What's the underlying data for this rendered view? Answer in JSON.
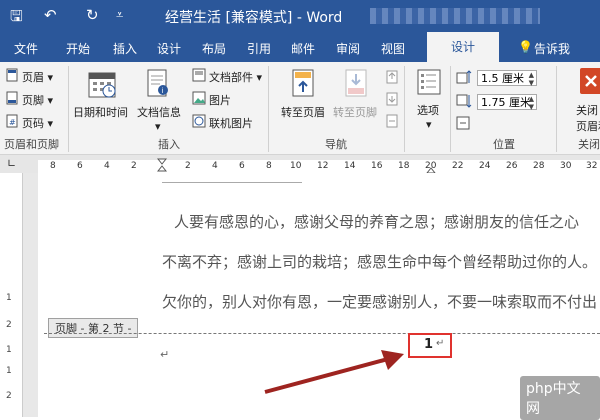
{
  "titlebar": {
    "title": "经营生活 [兼容模式] - Word",
    "quick_access": [
      {
        "name": "save-icon",
        "glyph": "🖫"
      },
      {
        "name": "undo-icon",
        "glyph": "↶"
      },
      {
        "name": "redo-icon",
        "glyph": "↻"
      },
      {
        "name": "customize-icon",
        "glyph": "⩡"
      }
    ]
  },
  "tabs": {
    "file": "文件",
    "home": "开始",
    "insert": "插入",
    "design": "设计",
    "layout": "布局",
    "references": "引用",
    "mailings": "邮件",
    "review": "审阅",
    "view": "视图",
    "hf_design": "设计",
    "tell_me": "告诉我"
  },
  "ribbon": {
    "header": "页眉",
    "footer": "页脚",
    "page_number": "页码",
    "group_hf": "页眉和页脚",
    "date_time": "日期和时间",
    "doc_info": "文档信息",
    "doc_parts": "文档部件",
    "picture": "图片",
    "online_picture": "联机图片",
    "group_insert": "插入",
    "goto_header": "转至页眉",
    "goto_footer": "转至页脚",
    "group_nav": "导航",
    "options": "选项",
    "header_pos": "1.5 厘米",
    "footer_pos": "1.75 厘米",
    "group_position": "位置",
    "close_line1": "关闭",
    "close_line2": "页眉和页",
    "group_close": "关闭"
  },
  "ruler": {
    "left_ticks": [
      "8",
      "6",
      "4",
      "2"
    ],
    "right_ticks": [
      "2",
      "4",
      "6",
      "8",
      "10",
      "12",
      "14",
      "16",
      "18",
      "20",
      "22",
      "24",
      "26",
      "28",
      "30",
      "32"
    ],
    "vertical_ticks": [
      "1",
      "2",
      "1",
      "1",
      "2"
    ]
  },
  "document": {
    "line0": "人要有感恩的心，感谢父母的养育之恩；感谢朋友的信任之心",
    "line1": "不离不弃；感谢上司的栽培；感恩生命中每个曾经帮助过你的人。",
    "line2": "欠你的，别人对你有恩，一定要感谢别人，不要一味索取而不付出",
    "footer_label": "页脚 - 第 2 节 -",
    "page_number": "1",
    "paragraph_mark": "↵"
  },
  "watermark": "php中文网",
  "colors": {
    "word_blue": "#2b579a",
    "highlight_red": "#e0322e",
    "arrow_red": "#9e2420"
  }
}
